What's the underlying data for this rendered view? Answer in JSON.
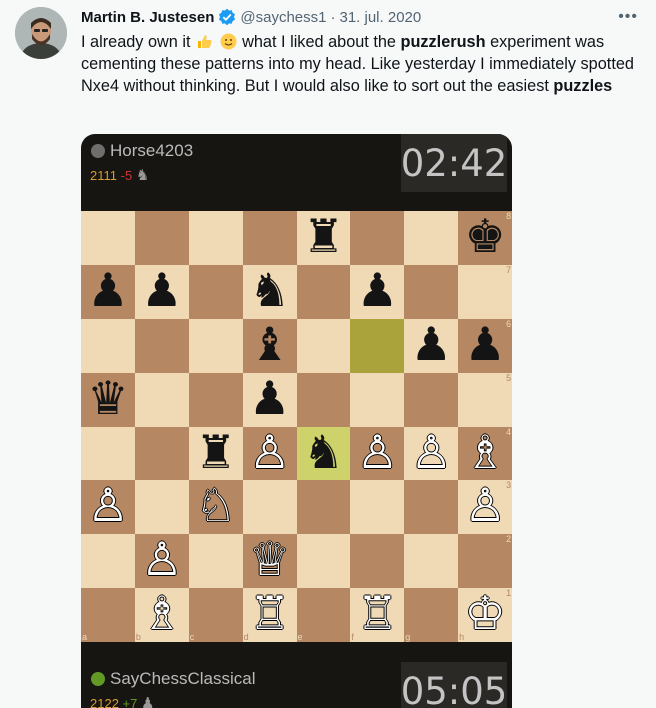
{
  "tweet": {
    "author_name": "Martin B. Justesen",
    "handle": "@saychess1",
    "separator": "·",
    "date": "31. jul. 2020",
    "more": "•••",
    "text": {
      "p1": "I already own it",
      "p2": " what I liked about the ",
      "bold1": "puzzlerush",
      "p3": " experiment was cementing these patterns into my head. Like yesterday I immediately spotted Nxe4 without thinking. But I would also like to sort out the easiest ",
      "bold2": "puzzles"
    },
    "emojis": [
      "thumbs-up",
      "slightly-smiling-face"
    ]
  },
  "game": {
    "top_player": {
      "name": "Horse4203",
      "rating": "2111",
      "diff": "-5",
      "clock": "02:42"
    },
    "bottom_player": {
      "name": "SayChessClassical",
      "rating": "2122",
      "diff": "+7",
      "clock": "05:05"
    },
    "files": [
      "a",
      "b",
      "c",
      "d",
      "e",
      "f",
      "g",
      "h"
    ],
    "ranks": [
      "8",
      "7",
      "6",
      "5",
      "4",
      "3",
      "2",
      "1"
    ],
    "highlight_squares": [
      "f6",
      "e4"
    ],
    "colors": {
      "light": "#f0d9b5",
      "dark": "#b58863",
      "highlight_light": "#cdd26a",
      "highlight_dark": "#aaa23a"
    },
    "pieces": [
      {
        "sq": "e8",
        "p": "♜",
        "c": "b"
      },
      {
        "sq": "h8",
        "p": "♚",
        "c": "b"
      },
      {
        "sq": "a7",
        "p": "♟",
        "c": "b"
      },
      {
        "sq": "b7",
        "p": "♟",
        "c": "b"
      },
      {
        "sq": "d7",
        "p": "♞",
        "c": "b"
      },
      {
        "sq": "f7",
        "p": "♟",
        "c": "b"
      },
      {
        "sq": "d6",
        "p": "♝",
        "c": "b"
      },
      {
        "sq": "g6",
        "p": "♟",
        "c": "b"
      },
      {
        "sq": "h6",
        "p": "♟",
        "c": "b"
      },
      {
        "sq": "a5",
        "p": "♛",
        "c": "b"
      },
      {
        "sq": "d5",
        "p": "♟",
        "c": "b"
      },
      {
        "sq": "c4",
        "p": "♜",
        "c": "b"
      },
      {
        "sq": "d4",
        "p": "♙",
        "c": "w"
      },
      {
        "sq": "e4",
        "p": "♞",
        "c": "b"
      },
      {
        "sq": "f4",
        "p": "♙",
        "c": "w"
      },
      {
        "sq": "g4",
        "p": "♙",
        "c": "w"
      },
      {
        "sq": "h4",
        "p": "♗",
        "c": "w"
      },
      {
        "sq": "a3",
        "p": "♙",
        "c": "w"
      },
      {
        "sq": "c3",
        "p": "♘",
        "c": "w"
      },
      {
        "sq": "h3",
        "p": "♙",
        "c": "w"
      },
      {
        "sq": "b2",
        "p": "♙",
        "c": "w"
      },
      {
        "sq": "d2",
        "p": "♕",
        "c": "w"
      },
      {
        "sq": "b1",
        "p": "♗",
        "c": "w"
      },
      {
        "sq": "d1",
        "p": "♖",
        "c": "w"
      },
      {
        "sq": "f1",
        "p": "♖",
        "c": "w"
      },
      {
        "sq": "h1",
        "p": "♔",
        "c": "w"
      }
    ]
  }
}
